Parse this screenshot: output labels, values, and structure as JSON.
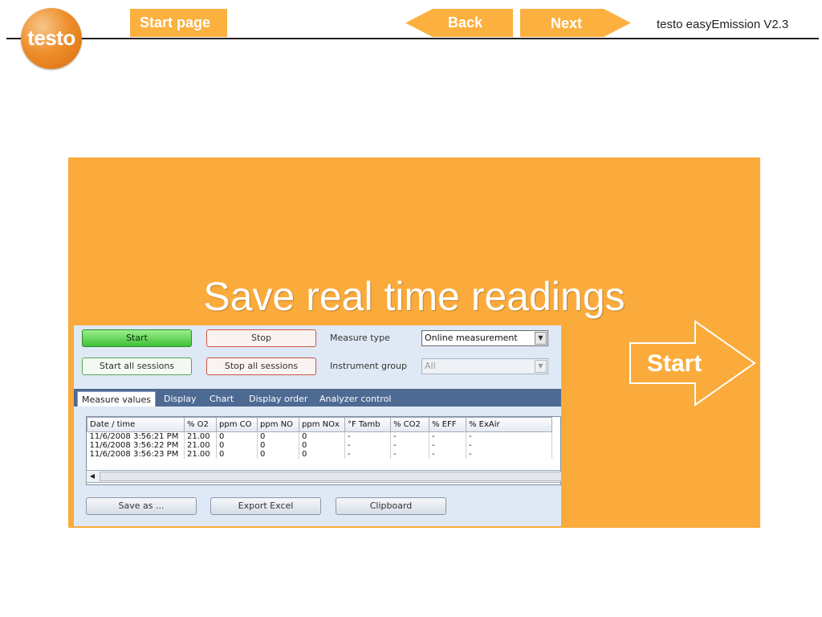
{
  "header": {
    "logo_text": "testo",
    "start_page": "Start page",
    "back": "Back",
    "next": "Next",
    "app_title": "testo easyEmission V2.3",
    "accent": "#fbb040"
  },
  "slide": {
    "headline": "Save real time readings",
    "start_arrow_label": "Start",
    "panel_color": "#fbab3b"
  },
  "app": {
    "buttons": {
      "start": "Start",
      "stop": "Stop",
      "start_all": "Start all sessions",
      "stop_all": "Stop all sessions",
      "save_as": "Save as ...",
      "export_excel": "Export Excel",
      "clipboard": "Clipboard"
    },
    "measure_type": {
      "label": "Measure type",
      "value": "Online measurement"
    },
    "instrument_group": {
      "label": "Instrument group",
      "value": "All"
    },
    "tabs": [
      "Measure values",
      "Display",
      "Chart",
      "Display order",
      "Analyzer control"
    ],
    "table": {
      "columns": [
        "Date / time",
        "% O2",
        "ppm CO",
        "ppm NO",
        "ppm NOx",
        "°F Tamb",
        "% CO2",
        "% EFF",
        "% ExAir"
      ],
      "rows": [
        [
          "11/6/2008 3:56:21 PM",
          "21.00",
          "0",
          "0",
          "0",
          "-",
          "-",
          "-",
          "-"
        ],
        [
          "11/6/2008 3:56:22 PM",
          "21.00",
          "0",
          "0",
          "0",
          "-",
          "-",
          "-",
          "-"
        ],
        [
          "11/6/2008 3:56:23 PM",
          "21.00",
          "0",
          "0",
          "0",
          "-",
          "-",
          "-",
          "-"
        ]
      ]
    }
  }
}
